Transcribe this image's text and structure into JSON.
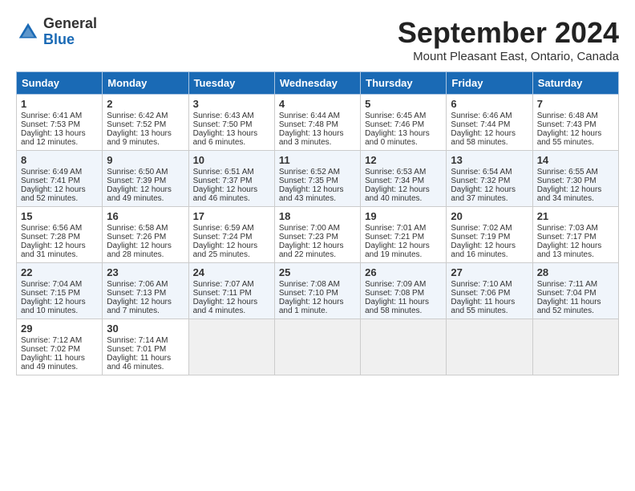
{
  "header": {
    "logo_general": "General",
    "logo_blue": "Blue",
    "month_title": "September 2024",
    "location": "Mount Pleasant East, Ontario, Canada"
  },
  "calendar": {
    "days_of_week": [
      "Sunday",
      "Monday",
      "Tuesday",
      "Wednesday",
      "Thursday",
      "Friday",
      "Saturday"
    ],
    "weeks": [
      [
        {
          "day": "1",
          "lines": [
            "Sunrise: 6:41 AM",
            "Sunset: 7:53 PM",
            "Daylight: 13 hours",
            "and 12 minutes."
          ]
        },
        {
          "day": "2",
          "lines": [
            "Sunrise: 6:42 AM",
            "Sunset: 7:52 PM",
            "Daylight: 13 hours",
            "and 9 minutes."
          ]
        },
        {
          "day": "3",
          "lines": [
            "Sunrise: 6:43 AM",
            "Sunset: 7:50 PM",
            "Daylight: 13 hours",
            "and 6 minutes."
          ]
        },
        {
          "day": "4",
          "lines": [
            "Sunrise: 6:44 AM",
            "Sunset: 7:48 PM",
            "Daylight: 13 hours",
            "and 3 minutes."
          ]
        },
        {
          "day": "5",
          "lines": [
            "Sunrise: 6:45 AM",
            "Sunset: 7:46 PM",
            "Daylight: 13 hours",
            "and 0 minutes."
          ]
        },
        {
          "day": "6",
          "lines": [
            "Sunrise: 6:46 AM",
            "Sunset: 7:44 PM",
            "Daylight: 12 hours",
            "and 58 minutes."
          ]
        },
        {
          "day": "7",
          "lines": [
            "Sunrise: 6:48 AM",
            "Sunset: 7:43 PM",
            "Daylight: 12 hours",
            "and 55 minutes."
          ]
        }
      ],
      [
        {
          "day": "8",
          "lines": [
            "Sunrise: 6:49 AM",
            "Sunset: 7:41 PM",
            "Daylight: 12 hours",
            "and 52 minutes."
          ]
        },
        {
          "day": "9",
          "lines": [
            "Sunrise: 6:50 AM",
            "Sunset: 7:39 PM",
            "Daylight: 12 hours",
            "and 49 minutes."
          ]
        },
        {
          "day": "10",
          "lines": [
            "Sunrise: 6:51 AM",
            "Sunset: 7:37 PM",
            "Daylight: 12 hours",
            "and 46 minutes."
          ]
        },
        {
          "day": "11",
          "lines": [
            "Sunrise: 6:52 AM",
            "Sunset: 7:35 PM",
            "Daylight: 12 hours",
            "and 43 minutes."
          ]
        },
        {
          "day": "12",
          "lines": [
            "Sunrise: 6:53 AM",
            "Sunset: 7:34 PM",
            "Daylight: 12 hours",
            "and 40 minutes."
          ]
        },
        {
          "day": "13",
          "lines": [
            "Sunrise: 6:54 AM",
            "Sunset: 7:32 PM",
            "Daylight: 12 hours",
            "and 37 minutes."
          ]
        },
        {
          "day": "14",
          "lines": [
            "Sunrise: 6:55 AM",
            "Sunset: 7:30 PM",
            "Daylight: 12 hours",
            "and 34 minutes."
          ]
        }
      ],
      [
        {
          "day": "15",
          "lines": [
            "Sunrise: 6:56 AM",
            "Sunset: 7:28 PM",
            "Daylight: 12 hours",
            "and 31 minutes."
          ]
        },
        {
          "day": "16",
          "lines": [
            "Sunrise: 6:58 AM",
            "Sunset: 7:26 PM",
            "Daylight: 12 hours",
            "and 28 minutes."
          ]
        },
        {
          "day": "17",
          "lines": [
            "Sunrise: 6:59 AM",
            "Sunset: 7:24 PM",
            "Daylight: 12 hours",
            "and 25 minutes."
          ]
        },
        {
          "day": "18",
          "lines": [
            "Sunrise: 7:00 AM",
            "Sunset: 7:23 PM",
            "Daylight: 12 hours",
            "and 22 minutes."
          ]
        },
        {
          "day": "19",
          "lines": [
            "Sunrise: 7:01 AM",
            "Sunset: 7:21 PM",
            "Daylight: 12 hours",
            "and 19 minutes."
          ]
        },
        {
          "day": "20",
          "lines": [
            "Sunrise: 7:02 AM",
            "Sunset: 7:19 PM",
            "Daylight: 12 hours",
            "and 16 minutes."
          ]
        },
        {
          "day": "21",
          "lines": [
            "Sunrise: 7:03 AM",
            "Sunset: 7:17 PM",
            "Daylight: 12 hours",
            "and 13 minutes."
          ]
        }
      ],
      [
        {
          "day": "22",
          "lines": [
            "Sunrise: 7:04 AM",
            "Sunset: 7:15 PM",
            "Daylight: 12 hours",
            "and 10 minutes."
          ]
        },
        {
          "day": "23",
          "lines": [
            "Sunrise: 7:06 AM",
            "Sunset: 7:13 PM",
            "Daylight: 12 hours",
            "and 7 minutes."
          ]
        },
        {
          "day": "24",
          "lines": [
            "Sunrise: 7:07 AM",
            "Sunset: 7:11 PM",
            "Daylight: 12 hours",
            "and 4 minutes."
          ]
        },
        {
          "day": "25",
          "lines": [
            "Sunrise: 7:08 AM",
            "Sunset: 7:10 PM",
            "Daylight: 12 hours",
            "and 1 minute."
          ]
        },
        {
          "day": "26",
          "lines": [
            "Sunrise: 7:09 AM",
            "Sunset: 7:08 PM",
            "Daylight: 11 hours",
            "and 58 minutes."
          ]
        },
        {
          "day": "27",
          "lines": [
            "Sunrise: 7:10 AM",
            "Sunset: 7:06 PM",
            "Daylight: 11 hours",
            "and 55 minutes."
          ]
        },
        {
          "day": "28",
          "lines": [
            "Sunrise: 7:11 AM",
            "Sunset: 7:04 PM",
            "Daylight: 11 hours",
            "and 52 minutes."
          ]
        }
      ],
      [
        {
          "day": "29",
          "lines": [
            "Sunrise: 7:12 AM",
            "Sunset: 7:02 PM",
            "Daylight: 11 hours",
            "and 49 minutes."
          ]
        },
        {
          "day": "30",
          "lines": [
            "Sunrise: 7:14 AM",
            "Sunset: 7:01 PM",
            "Daylight: 11 hours",
            "and 46 minutes."
          ]
        },
        {
          "day": "",
          "lines": []
        },
        {
          "day": "",
          "lines": []
        },
        {
          "day": "",
          "lines": []
        },
        {
          "day": "",
          "lines": []
        },
        {
          "day": "",
          "lines": []
        }
      ]
    ]
  }
}
